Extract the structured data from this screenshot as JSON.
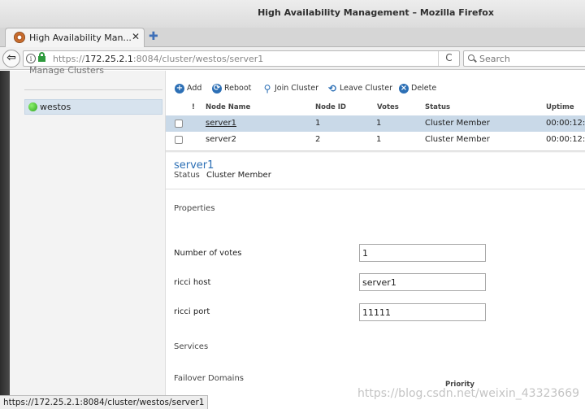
{
  "window": {
    "title": "High Availability Management – Mozilla Firefox"
  },
  "tab": {
    "label": "High Availability Man...",
    "close_glyph": "✕",
    "newtab_glyph": "✚"
  },
  "nav": {
    "back_glyph": "⇦",
    "url_scheme": "https://",
    "url_host": "172.25.2.1",
    "url_path": ":8084/cluster/westos/server1",
    "reload_glyph": "C",
    "search_placeholder": "Search"
  },
  "sidebar": {
    "heading": "Manage Clusters",
    "clusters": [
      {
        "name": "westos",
        "status_color": "#2fa61c"
      }
    ]
  },
  "toolbar": {
    "add": "Add",
    "reboot": "Reboot",
    "join": "Join Cluster",
    "leave": "Leave Cluster",
    "delete": "Delete"
  },
  "nodes": {
    "columns": {
      "flag": "!",
      "name": "Node Name",
      "id": "Node ID",
      "votes": "Votes",
      "status": "Status",
      "uptime": "Uptime"
    },
    "rows": [
      {
        "name": "server1",
        "id": "1",
        "votes": "1",
        "status": "Cluster Member",
        "uptime": "00:00:12:",
        "selected": true
      },
      {
        "name": "server2",
        "id": "2",
        "votes": "1",
        "status": "Cluster Member",
        "uptime": "00:00:12:",
        "selected": false
      }
    ]
  },
  "detail": {
    "title": "server1",
    "status_label": "Status",
    "status_value": "Cluster Member",
    "properties_heading": "Properties",
    "votes_label": "Number of votes",
    "votes_value": "1",
    "ricci_host_label": "ricci host",
    "ricci_host_value": "server1",
    "ricci_port_label": "ricci port",
    "ricci_port_value": "11111",
    "services_heading": "Services",
    "failover_heading": "Failover Domains",
    "priority_label": "Priority"
  },
  "statusbar": {
    "url": "https://172.25.2.1:8084/cluster/westos/server1"
  },
  "watermark": "https://blog.csdn.net/weixin_43323669",
  "colors": {
    "accent": "#2c6fb5",
    "selected_row": "#c9d9e8",
    "status_ok": "#2fa61c"
  }
}
